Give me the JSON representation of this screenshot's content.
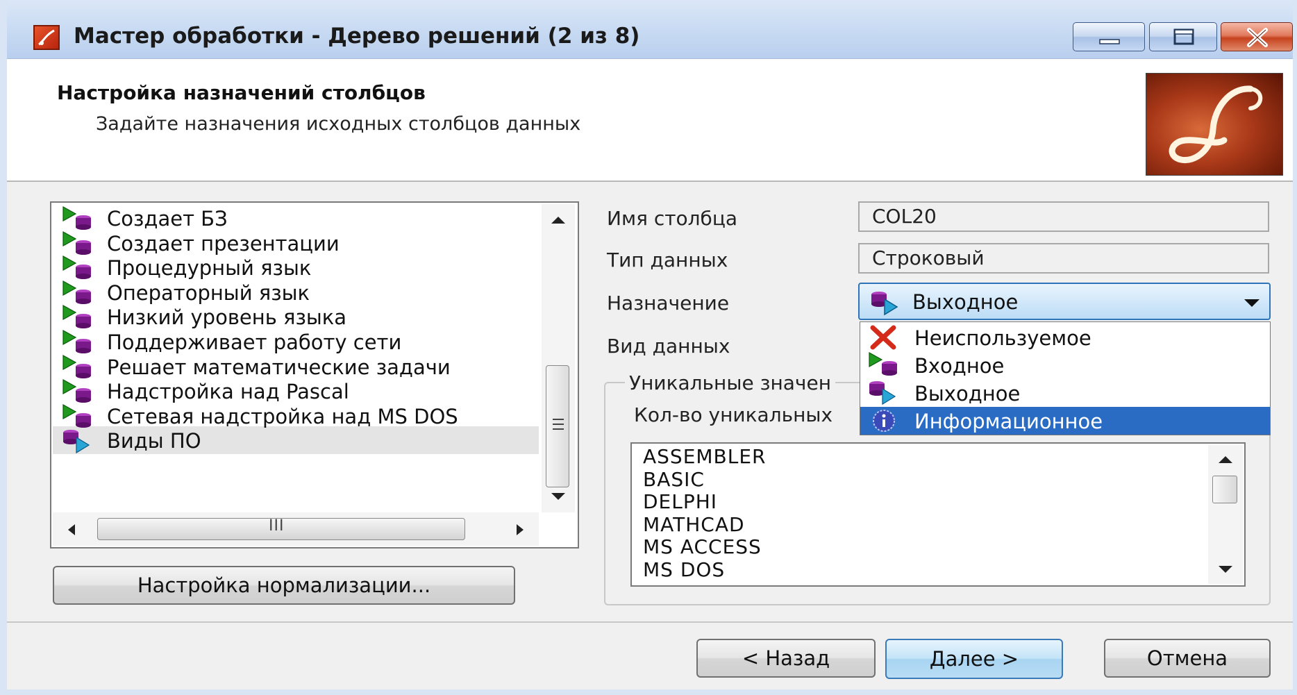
{
  "window": {
    "title": "Мастер обработки - Дерево решений (2 из 8)"
  },
  "header": {
    "title": "Настройка назначений столбцов",
    "subtitle": "Задайте назначения исходных столбцов данных"
  },
  "columns_list": {
    "items": [
      {
        "label": "Создает БЗ",
        "role": "input"
      },
      {
        "label": "Создает презентации",
        "role": "input"
      },
      {
        "label": "Процедурный язык",
        "role": "input"
      },
      {
        "label": "Операторный язык",
        "role": "input"
      },
      {
        "label": "Низкий уровень языка",
        "role": "input"
      },
      {
        "label": "Поддерживает работу сети",
        "role": "input"
      },
      {
        "label": "Решает математические задачи",
        "role": "input"
      },
      {
        "label": "Надстройка над Pascal",
        "role": "input"
      },
      {
        "label": "Сетевая надстройка над MS DOS",
        "role": "input"
      },
      {
        "label": "Виды ПО",
        "role": "output",
        "selected": true
      }
    ],
    "hscroll_glyph": "III"
  },
  "normalization_button": "Настройка нормализации...",
  "properties": {
    "column_name_label": "Имя столбца",
    "column_name_value": "COL20",
    "data_type_label": "Тип данных",
    "data_type_value": "Строковый",
    "purpose_label": "Назначение",
    "purpose_value": "Выходное",
    "data_kind_label": "Вид данных"
  },
  "purpose_options": [
    {
      "label": "Неиспользуемое",
      "icon": "unused-x-icon"
    },
    {
      "label": "Входное",
      "icon": "input-icon"
    },
    {
      "label": "Выходное",
      "icon": "output-icon"
    },
    {
      "label": "Информационное",
      "icon": "info-icon",
      "selected": true
    }
  ],
  "unique_values": {
    "group_title": "Уникальные значен",
    "count_label": "Кол-во уникальных",
    "values": [
      "ASSEMBLER",
      "BASIC",
      "DELPHI",
      "MATHCAD",
      "MS ACCESS",
      "MS DOS"
    ]
  },
  "footer": {
    "back": "< Назад",
    "next": "Далее >",
    "cancel": "Отмена"
  },
  "colors": {
    "accent": "#2a6cc4",
    "input_arrow": "#1f9a1f",
    "role_cylinder": "#7a1a8a",
    "output_arrow": "#29a6d6"
  }
}
